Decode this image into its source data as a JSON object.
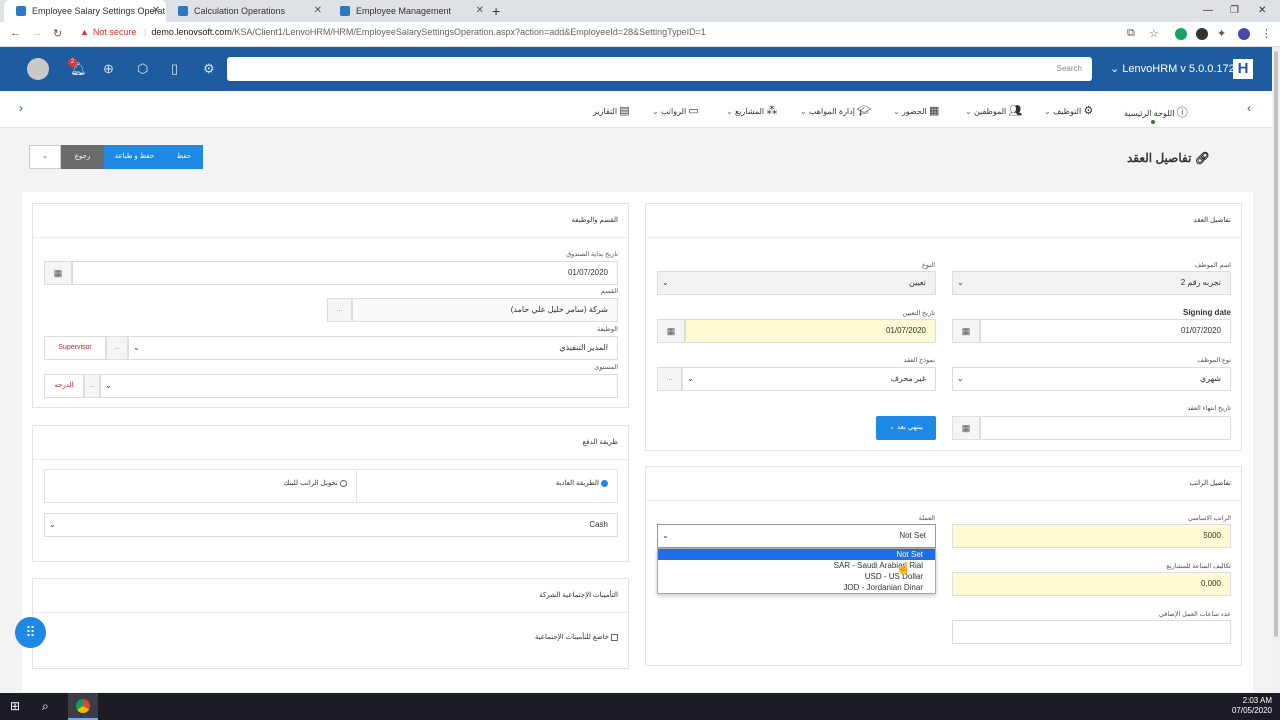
{
  "browser": {
    "tabs": [
      {
        "title": "Employee Salary Settings Operat"
      },
      {
        "title": "Calculation Operations"
      },
      {
        "title": "Employee Management"
      }
    ],
    "address": {
      "security": "Not secure",
      "host": "demo.lenovsoft.com",
      "path": "/KSA/Client1/LenvoHRM/HRM/EmployeeSalarySettingsOperation.aspx?action=add&EmployeeId=28&SettingTypeID=1"
    }
  },
  "header": {
    "notification_count": "2",
    "search_placeholder": "Search",
    "version": "LenvoHRM v 5.0.0.172",
    "logo_letter": "H"
  },
  "menu": {
    "items": [
      {
        "label": "اللوحة الرئيسية",
        "icon": "info-icon"
      },
      {
        "label": "التوظيف",
        "icon": "gear-icon"
      },
      {
        "label": "الموظفين",
        "icon": "users-icon"
      },
      {
        "label": "الحضور",
        "icon": "calendar-icon"
      },
      {
        "label": "إدارة المواهب",
        "icon": "graduation-cap-icon"
      },
      {
        "label": "المشاريع",
        "icon": "network-icon"
      },
      {
        "label": "الرواتب",
        "icon": "money-icon"
      },
      {
        "label": "التقارير",
        "icon": "document-icon"
      }
    ]
  },
  "toolbar": {
    "save": "حفظ",
    "save_print": "حفظ و طباعة",
    "back": "رجوع",
    "more": "⌄"
  },
  "page": {
    "title": "تفاصيل العقد"
  },
  "contract": {
    "title": "تفاصيل العقد",
    "employee_name_label": "اسم الموظف",
    "employee_name_value": "تجربه رقم 2",
    "type_label": "النوع",
    "type_value": "تعيين",
    "signing_date_label": "Signing date",
    "signing_date_value": "01/07/2020",
    "hiring_date_label": "تاريخ التعيين",
    "hiring_date_value": "01/07/2020",
    "employee_type_label": "نوع الموظف",
    "employee_type_value": "شهري",
    "contract_model_label": "نموذج العقد",
    "contract_model_value": "غير محرف",
    "end_date_label": "تاريخ انتهاء العقد",
    "no_end_button": "ينتهي بعد"
  },
  "salary": {
    "title": "تفاصيل الراتب",
    "basic_label": "الراتب الاساسي",
    "basic_value": "5000",
    "currency_label": "العملة",
    "currency_value": "Not Set",
    "currency_options": [
      "Not Set",
      "SAR - Saudi Arabian Rial",
      "USD - US Dollar",
      "JOD - Jordanian Dinar"
    ],
    "hour_cost_label": "تكاليف الساعة للمشاريع",
    "hour_cost_value": "0.000",
    "overtime_label": "عدد ساعات العمل الإضافي"
  },
  "dept": {
    "title": "القسم والوظيفة",
    "fund_date_label": "تاريخ بداية الصندوق",
    "fund_date_value": "01/07/2020",
    "department_label": "القسم",
    "department_value": "شركة (سامر خليل علي حامد)",
    "job_label": "الوظيفة",
    "job_value": "المدير التنفيذي",
    "job_tag": "Supervisor",
    "level_label": "المستوى",
    "level_tag": "الدرجه",
    "ellipsis": "..."
  },
  "payment": {
    "title": "طريقة الدفع",
    "option_normal": "الطريقة العادية",
    "option_bank": "تحويل الراتب للبنك",
    "method_value": "Cash"
  },
  "insurance": {
    "title": "التأمينات الإجتماعية الشركة",
    "checkbox_label": "خاضع للتأمينات الإجتماعية"
  },
  "taskbar": {
    "time": "2:03 AM",
    "date": "07/05/2020"
  }
}
